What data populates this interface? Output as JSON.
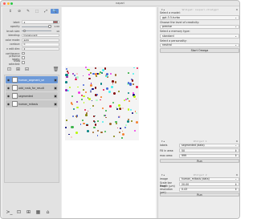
{
  "window": {
    "title": "napari"
  },
  "tools": {
    "row1": [
      "↕",
      "⊘",
      "✎",
      "⬚",
      "⤢",
      "🔍"
    ]
  },
  "props": [
    {
      "kind": "spin",
      "label": "label:",
      "value": "2"
    },
    {
      "kind": "slider",
      "label": "opacity:",
      "value": "1.00",
      "fraction": 0.95
    },
    {
      "kind": "slider",
      "label": "brush size:",
      "value": "10",
      "fraction": 0.1
    },
    {
      "kind": "select",
      "label": "blending:",
      "value": "translucent"
    },
    {
      "kind": "select",
      "label": "color mode:",
      "value": "auto"
    },
    {
      "kind": "spin",
      "label": "contour:",
      "value": "0"
    },
    {
      "kind": "spin",
      "label": "n edit dim:",
      "value": "2"
    },
    {
      "kind": "check",
      "label": "contiguous:"
    },
    {
      "kind": "check",
      "label": "preserve labels:"
    },
    {
      "kind": "check",
      "label": "show selected:"
    }
  ],
  "layer_tools": [
    "⊡",
    "⊞",
    "⊟"
  ],
  "trash": "🗑",
  "layers": [
    {
      "name": "human_segment_se",
      "selected": true
    },
    {
      "name": "add_rvals_for_result",
      "selected": false
    },
    {
      "name": "segmented",
      "selected": false
    },
    {
      "name": "human_mitosis",
      "selected": false
    }
  ],
  "bottom_tools": [
    ">_",
    "⊡",
    "⊞",
    "▦",
    "⌂"
  ],
  "canvas_footer": "",
  "dock_top": {
    "header": "Widget: napari-chatgpt",
    "model_label": "Select a model:",
    "model_value": "gpt-3.5-turbo",
    "creativity_label": "Choose the level of creativity:",
    "creativity_value": "precise",
    "memory_label": "Select a memory type:",
    "memory_value": "standard",
    "personality_label": "Select a personality:",
    "personality_value": "neutral",
    "start_button": "Start Omega"
  },
  "dock_mid": {
    "header": "Widget 1",
    "labels_label": "labels",
    "labels_value": "segmented (data)",
    "fill_label": "Fill in area:",
    "fill_value": "50",
    "max_label": "max area:",
    "max_value": "999",
    "run_button": "Run"
  },
  "dock_bot": {
    "header": "Widget 2",
    "image_label": "image",
    "image_value": "human_mitosis (data)",
    "scale_label": "Scale bar length (µm)",
    "scale_value": "20.00",
    "pixel_label": "Pixel resolution (µm)",
    "pixel_value": "0.43",
    "run_button": "Run"
  },
  "colors": {
    "selected_layer": "#6e9ad8",
    "active_tool": "#5b8fd9"
  }
}
